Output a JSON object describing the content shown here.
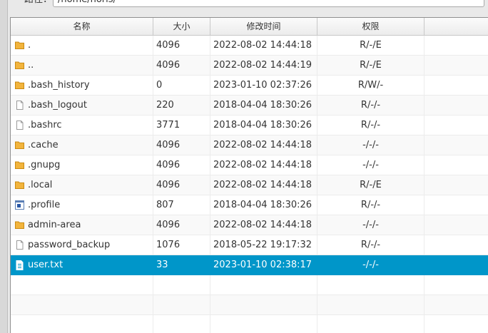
{
  "path_bar": {
    "label": "路径：",
    "value": "/home/noris/"
  },
  "table": {
    "columns": [
      "名称",
      "大小",
      "修改时间",
      "权限"
    ],
    "rows": [
      {
        "name": ".",
        "size": "4096",
        "modified": "2022-08-02 14:44:18",
        "perms": "R/-/E",
        "icon": "folder-icon"
      },
      {
        "name": "..",
        "size": "4096",
        "modified": "2022-08-02 14:44:19",
        "perms": "R/-/E",
        "icon": "folder-icon"
      },
      {
        "name": ".bash_history",
        "size": "0",
        "modified": "2023-01-10 02:37:26",
        "perms": "R/W/-",
        "icon": "folder-icon"
      },
      {
        "name": ".bash_logout",
        "size": "220",
        "modified": "2018-04-04 18:30:26",
        "perms": "R/-/-",
        "icon": "file-icon"
      },
      {
        "name": ".bashrc",
        "size": "3771",
        "modified": "2018-04-04 18:30:26",
        "perms": "R/-/-",
        "icon": "file-icon"
      },
      {
        "name": ".cache",
        "size": "4096",
        "modified": "2022-08-02 14:44:18",
        "perms": "-/-/-",
        "icon": "folder-icon"
      },
      {
        "name": ".gnupg",
        "size": "4096",
        "modified": "2022-08-02 14:44:18",
        "perms": "-/-/-",
        "icon": "folder-icon"
      },
      {
        "name": ".local",
        "size": "4096",
        "modified": "2022-08-02 14:44:18",
        "perms": "R/-/E",
        "icon": "folder-icon"
      },
      {
        "name": ".profile",
        "size": "807",
        "modified": "2018-04-04 18:30:26",
        "perms": "R/-/-",
        "icon": "window-file-icon"
      },
      {
        "name": "admin-area",
        "size": "4096",
        "modified": "2022-08-02 14:44:18",
        "perms": "-/-/-",
        "icon": "folder-icon"
      },
      {
        "name": "password_backup",
        "size": "1076",
        "modified": "2018-05-22 19:17:32",
        "perms": "R/-/-",
        "icon": "file-icon"
      },
      {
        "name": "user.txt",
        "size": "33",
        "modified": "2023-01-10 02:38:17",
        "perms": "-/-/-",
        "icon": "text-file-icon",
        "selected": true
      }
    ]
  },
  "colors": {
    "selection": "#0096c9",
    "folder": "#f2b43c"
  }
}
